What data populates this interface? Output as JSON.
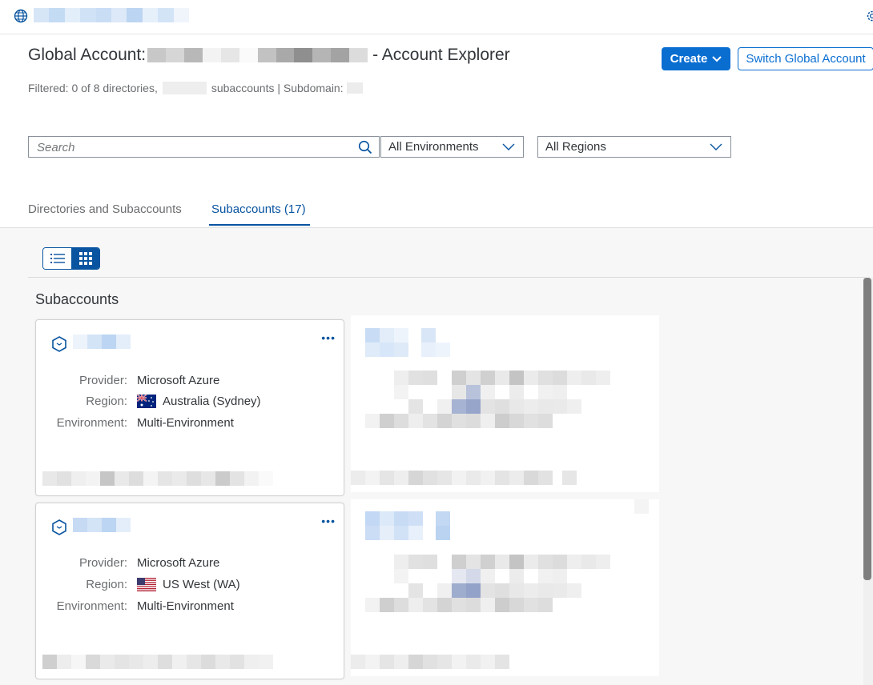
{
  "header": {
    "title_prefix": "Global Account:",
    "title_suffix": "- Account Explorer",
    "subtitle_filtered": "Filtered: 0 of 8 directories,",
    "subtitle_subaccounts": "subaccounts | Subdomain:",
    "create_label": "Create",
    "switch_label": "Switch Global Account"
  },
  "filters": {
    "search_placeholder": "Search",
    "environments_value": "All Environments",
    "regions_value": "All Regions"
  },
  "tabs": [
    {
      "label": "Directories and Subaccounts",
      "active": false
    },
    {
      "label": "Subaccounts (17)",
      "active": true
    }
  ],
  "section_title": "Subaccounts",
  "cards": [
    {
      "more": "•••",
      "provider_label": "Provider:",
      "provider_value": "Microsoft Azure",
      "region_label": "Region:",
      "region_value": "Australia (Sydney)",
      "region_flag": "australia-flag",
      "environment_label": "Environment:",
      "environment_value": "Multi-Environment"
    },
    {
      "more": "•••",
      "provider_label": "Provider:",
      "provider_value": "Microsoft Azure",
      "region_label": "Region:",
      "region_value": "US West (WA)",
      "region_flag": "us-flag",
      "environment_label": "Environment:",
      "environment_value": "Multi-Environment"
    }
  ],
  "colors": {
    "accent": "#0a6ed1",
    "active_tab": "#0854a0",
    "text": "#32363a",
    "muted": "#6a6d70"
  },
  "icons": [
    "globe-icon",
    "gear-icon",
    "search-icon",
    "chevron-down-icon",
    "list-view-icon",
    "grid-view-icon",
    "subaccount-icon",
    "more-icon"
  ]
}
